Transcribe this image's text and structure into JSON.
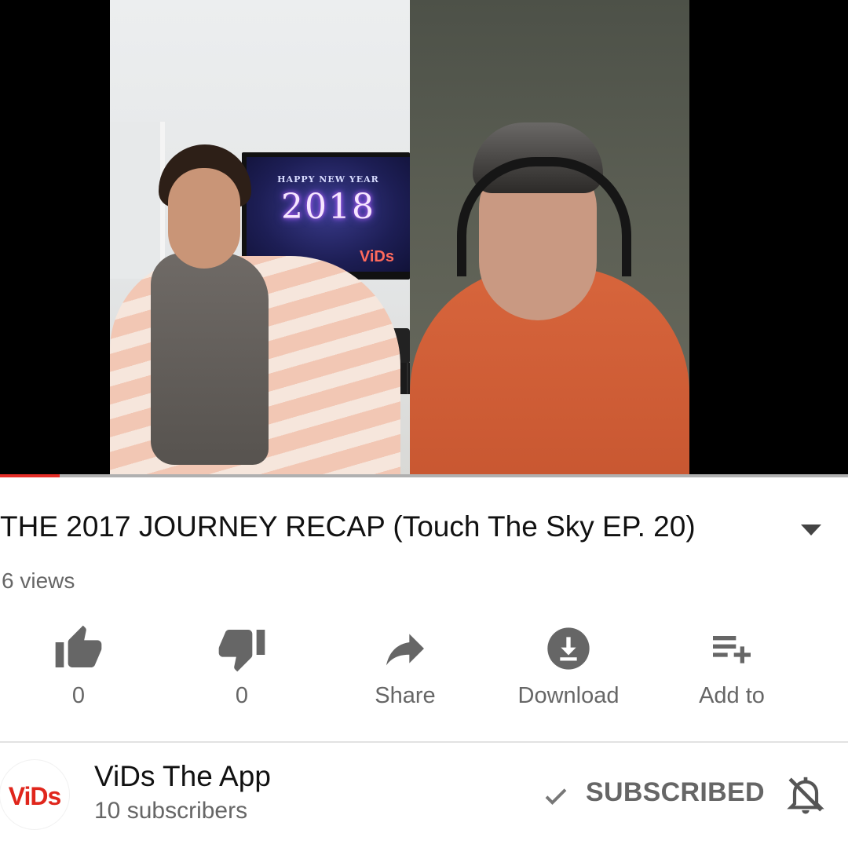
{
  "video": {
    "tv_greeting": "HAPPY NEW YEAR",
    "tv_year": "2018",
    "tv_brand": "ViDs",
    "progress_fraction": 0.07
  },
  "meta": {
    "title": "THE 2017 JOURNEY RECAP (Touch The Sky EP. 20)",
    "views": "6 views"
  },
  "actions": [
    {
      "icon": "thumbs-up-icon",
      "label": "0"
    },
    {
      "icon": "thumbs-down-icon",
      "label": "0"
    },
    {
      "icon": "share-icon",
      "label": "Share"
    },
    {
      "icon": "download-icon",
      "label": "Download"
    },
    {
      "icon": "add-to-playlist-icon",
      "label": "Add to"
    }
  ],
  "channel": {
    "avatar_text": "ViDs",
    "name": "ViDs The App",
    "subscribers": "10 subscribers",
    "subscribe_label": "SUBSCRIBED"
  },
  "colors": {
    "accent": "#e52d27",
    "text_primary": "#111111",
    "text_secondary": "#666666"
  }
}
